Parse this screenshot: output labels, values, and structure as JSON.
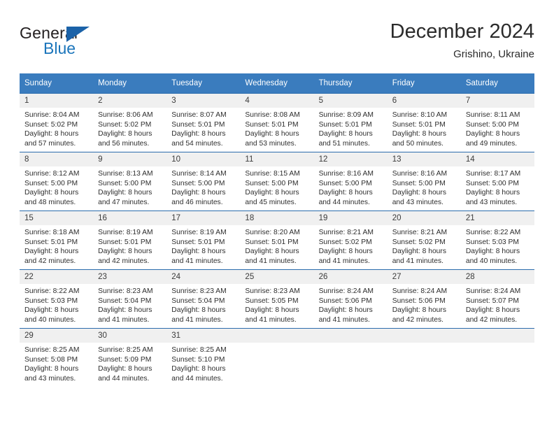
{
  "brand": {
    "word_general": "General",
    "word_blue": "Blue",
    "flag_icon": "triangle-flag-icon"
  },
  "header": {
    "title": "December 2024",
    "subtitle": "Grishino, Ukraine"
  },
  "colors": {
    "header_row": "#3a7cbe",
    "grid_line": "#2b6cad",
    "daynum_band": "#f0f0f0",
    "brand_blue": "#1b75bb"
  },
  "weekday_headers": [
    "Sunday",
    "Monday",
    "Tuesday",
    "Wednesday",
    "Thursday",
    "Friday",
    "Saturday"
  ],
  "weeks": [
    [
      {
        "day": "1",
        "sunrise": "Sunrise: 8:04 AM",
        "sunset": "Sunset: 5:02 PM",
        "daylight1": "Daylight: 8 hours",
        "daylight2": "and 57 minutes."
      },
      {
        "day": "2",
        "sunrise": "Sunrise: 8:06 AM",
        "sunset": "Sunset: 5:02 PM",
        "daylight1": "Daylight: 8 hours",
        "daylight2": "and 56 minutes."
      },
      {
        "day": "3",
        "sunrise": "Sunrise: 8:07 AM",
        "sunset": "Sunset: 5:01 PM",
        "daylight1": "Daylight: 8 hours",
        "daylight2": "and 54 minutes."
      },
      {
        "day": "4",
        "sunrise": "Sunrise: 8:08 AM",
        "sunset": "Sunset: 5:01 PM",
        "daylight1": "Daylight: 8 hours",
        "daylight2": "and 53 minutes."
      },
      {
        "day": "5",
        "sunrise": "Sunrise: 8:09 AM",
        "sunset": "Sunset: 5:01 PM",
        "daylight1": "Daylight: 8 hours",
        "daylight2": "and 51 minutes."
      },
      {
        "day": "6",
        "sunrise": "Sunrise: 8:10 AM",
        "sunset": "Sunset: 5:01 PM",
        "daylight1": "Daylight: 8 hours",
        "daylight2": "and 50 minutes."
      },
      {
        "day": "7",
        "sunrise": "Sunrise: 8:11 AM",
        "sunset": "Sunset: 5:00 PM",
        "daylight1": "Daylight: 8 hours",
        "daylight2": "and 49 minutes."
      }
    ],
    [
      {
        "day": "8",
        "sunrise": "Sunrise: 8:12 AM",
        "sunset": "Sunset: 5:00 PM",
        "daylight1": "Daylight: 8 hours",
        "daylight2": "and 48 minutes."
      },
      {
        "day": "9",
        "sunrise": "Sunrise: 8:13 AM",
        "sunset": "Sunset: 5:00 PM",
        "daylight1": "Daylight: 8 hours",
        "daylight2": "and 47 minutes."
      },
      {
        "day": "10",
        "sunrise": "Sunrise: 8:14 AM",
        "sunset": "Sunset: 5:00 PM",
        "daylight1": "Daylight: 8 hours",
        "daylight2": "and 46 minutes."
      },
      {
        "day": "11",
        "sunrise": "Sunrise: 8:15 AM",
        "sunset": "Sunset: 5:00 PM",
        "daylight1": "Daylight: 8 hours",
        "daylight2": "and 45 minutes."
      },
      {
        "day": "12",
        "sunrise": "Sunrise: 8:16 AM",
        "sunset": "Sunset: 5:00 PM",
        "daylight1": "Daylight: 8 hours",
        "daylight2": "and 44 minutes."
      },
      {
        "day": "13",
        "sunrise": "Sunrise: 8:16 AM",
        "sunset": "Sunset: 5:00 PM",
        "daylight1": "Daylight: 8 hours",
        "daylight2": "and 43 minutes."
      },
      {
        "day": "14",
        "sunrise": "Sunrise: 8:17 AM",
        "sunset": "Sunset: 5:00 PM",
        "daylight1": "Daylight: 8 hours",
        "daylight2": "and 43 minutes."
      }
    ],
    [
      {
        "day": "15",
        "sunrise": "Sunrise: 8:18 AM",
        "sunset": "Sunset: 5:01 PM",
        "daylight1": "Daylight: 8 hours",
        "daylight2": "and 42 minutes."
      },
      {
        "day": "16",
        "sunrise": "Sunrise: 8:19 AM",
        "sunset": "Sunset: 5:01 PM",
        "daylight1": "Daylight: 8 hours",
        "daylight2": "and 42 minutes."
      },
      {
        "day": "17",
        "sunrise": "Sunrise: 8:19 AM",
        "sunset": "Sunset: 5:01 PM",
        "daylight1": "Daylight: 8 hours",
        "daylight2": "and 41 minutes."
      },
      {
        "day": "18",
        "sunrise": "Sunrise: 8:20 AM",
        "sunset": "Sunset: 5:01 PM",
        "daylight1": "Daylight: 8 hours",
        "daylight2": "and 41 minutes."
      },
      {
        "day": "19",
        "sunrise": "Sunrise: 8:21 AM",
        "sunset": "Sunset: 5:02 PM",
        "daylight1": "Daylight: 8 hours",
        "daylight2": "and 41 minutes."
      },
      {
        "day": "20",
        "sunrise": "Sunrise: 8:21 AM",
        "sunset": "Sunset: 5:02 PM",
        "daylight1": "Daylight: 8 hours",
        "daylight2": "and 41 minutes."
      },
      {
        "day": "21",
        "sunrise": "Sunrise: 8:22 AM",
        "sunset": "Sunset: 5:03 PM",
        "daylight1": "Daylight: 8 hours",
        "daylight2": "and 40 minutes."
      }
    ],
    [
      {
        "day": "22",
        "sunrise": "Sunrise: 8:22 AM",
        "sunset": "Sunset: 5:03 PM",
        "daylight1": "Daylight: 8 hours",
        "daylight2": "and 40 minutes."
      },
      {
        "day": "23",
        "sunrise": "Sunrise: 8:23 AM",
        "sunset": "Sunset: 5:04 PM",
        "daylight1": "Daylight: 8 hours",
        "daylight2": "and 41 minutes."
      },
      {
        "day": "24",
        "sunrise": "Sunrise: 8:23 AM",
        "sunset": "Sunset: 5:04 PM",
        "daylight1": "Daylight: 8 hours",
        "daylight2": "and 41 minutes."
      },
      {
        "day": "25",
        "sunrise": "Sunrise: 8:23 AM",
        "sunset": "Sunset: 5:05 PM",
        "daylight1": "Daylight: 8 hours",
        "daylight2": "and 41 minutes."
      },
      {
        "day": "26",
        "sunrise": "Sunrise: 8:24 AM",
        "sunset": "Sunset: 5:06 PM",
        "daylight1": "Daylight: 8 hours",
        "daylight2": "and 41 minutes."
      },
      {
        "day": "27",
        "sunrise": "Sunrise: 8:24 AM",
        "sunset": "Sunset: 5:06 PM",
        "daylight1": "Daylight: 8 hours",
        "daylight2": "and 42 minutes."
      },
      {
        "day": "28",
        "sunrise": "Sunrise: 8:24 AM",
        "sunset": "Sunset: 5:07 PM",
        "daylight1": "Daylight: 8 hours",
        "daylight2": "and 42 minutes."
      }
    ],
    [
      {
        "day": "29",
        "sunrise": "Sunrise: 8:25 AM",
        "sunset": "Sunset: 5:08 PM",
        "daylight1": "Daylight: 8 hours",
        "daylight2": "and 43 minutes."
      },
      {
        "day": "30",
        "sunrise": "Sunrise: 8:25 AM",
        "sunset": "Sunset: 5:09 PM",
        "daylight1": "Daylight: 8 hours",
        "daylight2": "and 44 minutes."
      },
      {
        "day": "31",
        "sunrise": "Sunrise: 8:25 AM",
        "sunset": "Sunset: 5:10 PM",
        "daylight1": "Daylight: 8 hours",
        "daylight2": "and 44 minutes."
      },
      {
        "day": "",
        "sunrise": "",
        "sunset": "",
        "daylight1": "",
        "daylight2": ""
      },
      {
        "day": "",
        "sunrise": "",
        "sunset": "",
        "daylight1": "",
        "daylight2": ""
      },
      {
        "day": "",
        "sunrise": "",
        "sunset": "",
        "daylight1": "",
        "daylight2": ""
      },
      {
        "day": "",
        "sunrise": "",
        "sunset": "",
        "daylight1": "",
        "daylight2": ""
      }
    ]
  ]
}
